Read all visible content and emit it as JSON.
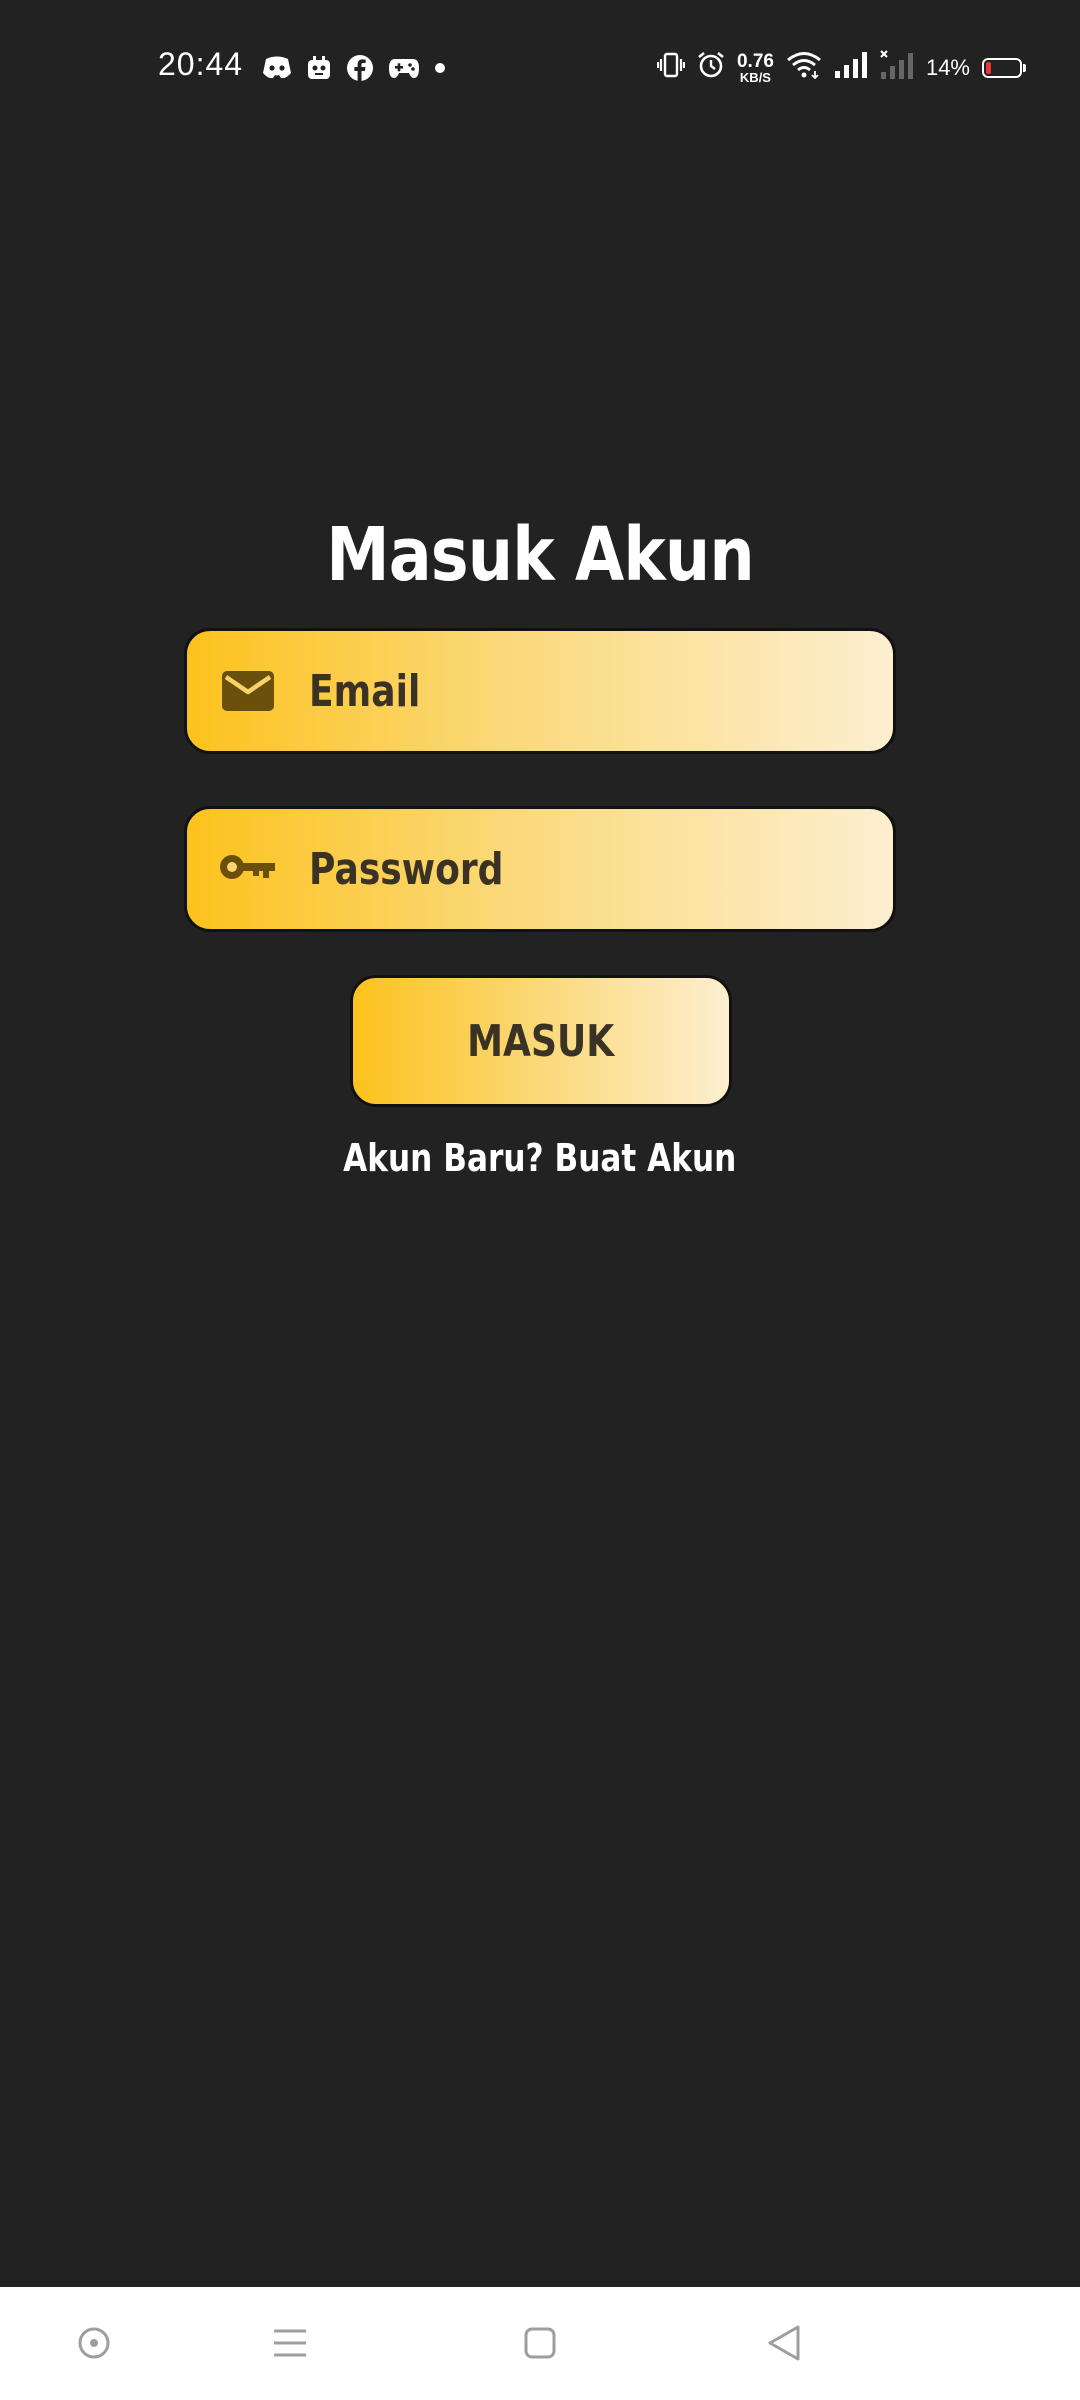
{
  "status_bar": {
    "time": "20:44",
    "left_icons": [
      "discord-icon",
      "mascot-app-icon",
      "facebook-icon",
      "gamepad-icon",
      "dot-icon"
    ],
    "net_speed_value": "0.76",
    "net_speed_unit": "KB/S",
    "battery_percent": "14%",
    "right_icons": [
      "vibrate-icon",
      "alarm-icon",
      "wifi-icon",
      "signal-icon",
      "signal-off-icon",
      "battery-icon"
    ]
  },
  "login": {
    "title": "Masuk Akun",
    "email_placeholder": "Email",
    "password_placeholder": "Password",
    "submit_label": "MASUK",
    "signup_text": "Akun Baru? Buat Akun"
  },
  "nav_bar": {
    "buttons": [
      "assistant-icon",
      "menu-icon",
      "home-icon",
      "back-icon"
    ]
  },
  "colors": {
    "background": "#222222",
    "accent_start": "#fcc21c",
    "accent_end": "#fcefd0",
    "field_text": "#3a3325",
    "icon_color": "#6b4f0c"
  }
}
